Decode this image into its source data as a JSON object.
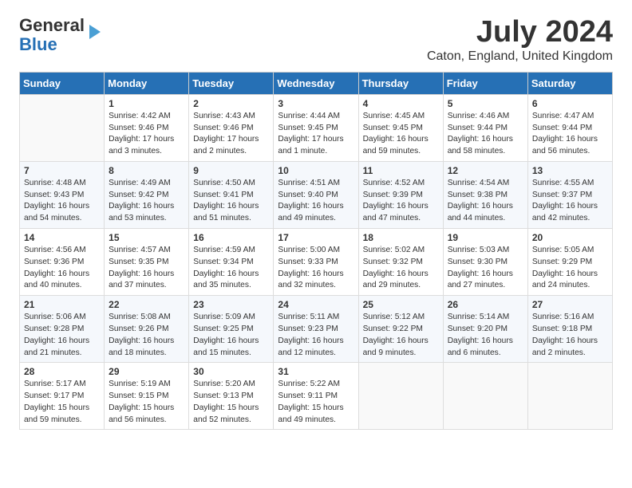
{
  "header": {
    "logo_line1": "General",
    "logo_line2": "Blue",
    "month_year": "July 2024",
    "location": "Caton, England, United Kingdom"
  },
  "calendar": {
    "weekdays": [
      "Sunday",
      "Monday",
      "Tuesday",
      "Wednesday",
      "Thursday",
      "Friday",
      "Saturday"
    ],
    "weeks": [
      [
        {
          "day": "",
          "info": ""
        },
        {
          "day": "1",
          "info": "Sunrise: 4:42 AM\nSunset: 9:46 PM\nDaylight: 17 hours\nand 3 minutes."
        },
        {
          "day": "2",
          "info": "Sunrise: 4:43 AM\nSunset: 9:46 PM\nDaylight: 17 hours\nand 2 minutes."
        },
        {
          "day": "3",
          "info": "Sunrise: 4:44 AM\nSunset: 9:45 PM\nDaylight: 17 hours\nand 1 minute."
        },
        {
          "day": "4",
          "info": "Sunrise: 4:45 AM\nSunset: 9:45 PM\nDaylight: 16 hours\nand 59 minutes."
        },
        {
          "day": "5",
          "info": "Sunrise: 4:46 AM\nSunset: 9:44 PM\nDaylight: 16 hours\nand 58 minutes."
        },
        {
          "day": "6",
          "info": "Sunrise: 4:47 AM\nSunset: 9:44 PM\nDaylight: 16 hours\nand 56 minutes."
        }
      ],
      [
        {
          "day": "7",
          "info": "Sunrise: 4:48 AM\nSunset: 9:43 PM\nDaylight: 16 hours\nand 54 minutes."
        },
        {
          "day": "8",
          "info": "Sunrise: 4:49 AM\nSunset: 9:42 PM\nDaylight: 16 hours\nand 53 minutes."
        },
        {
          "day": "9",
          "info": "Sunrise: 4:50 AM\nSunset: 9:41 PM\nDaylight: 16 hours\nand 51 minutes."
        },
        {
          "day": "10",
          "info": "Sunrise: 4:51 AM\nSunset: 9:40 PM\nDaylight: 16 hours\nand 49 minutes."
        },
        {
          "day": "11",
          "info": "Sunrise: 4:52 AM\nSunset: 9:39 PM\nDaylight: 16 hours\nand 47 minutes."
        },
        {
          "day": "12",
          "info": "Sunrise: 4:54 AM\nSunset: 9:38 PM\nDaylight: 16 hours\nand 44 minutes."
        },
        {
          "day": "13",
          "info": "Sunrise: 4:55 AM\nSunset: 9:37 PM\nDaylight: 16 hours\nand 42 minutes."
        }
      ],
      [
        {
          "day": "14",
          "info": "Sunrise: 4:56 AM\nSunset: 9:36 PM\nDaylight: 16 hours\nand 40 minutes."
        },
        {
          "day": "15",
          "info": "Sunrise: 4:57 AM\nSunset: 9:35 PM\nDaylight: 16 hours\nand 37 minutes."
        },
        {
          "day": "16",
          "info": "Sunrise: 4:59 AM\nSunset: 9:34 PM\nDaylight: 16 hours\nand 35 minutes."
        },
        {
          "day": "17",
          "info": "Sunrise: 5:00 AM\nSunset: 9:33 PM\nDaylight: 16 hours\nand 32 minutes."
        },
        {
          "day": "18",
          "info": "Sunrise: 5:02 AM\nSunset: 9:32 PM\nDaylight: 16 hours\nand 29 minutes."
        },
        {
          "day": "19",
          "info": "Sunrise: 5:03 AM\nSunset: 9:30 PM\nDaylight: 16 hours\nand 27 minutes."
        },
        {
          "day": "20",
          "info": "Sunrise: 5:05 AM\nSunset: 9:29 PM\nDaylight: 16 hours\nand 24 minutes."
        }
      ],
      [
        {
          "day": "21",
          "info": "Sunrise: 5:06 AM\nSunset: 9:28 PM\nDaylight: 16 hours\nand 21 minutes."
        },
        {
          "day": "22",
          "info": "Sunrise: 5:08 AM\nSunset: 9:26 PM\nDaylight: 16 hours\nand 18 minutes."
        },
        {
          "day": "23",
          "info": "Sunrise: 5:09 AM\nSunset: 9:25 PM\nDaylight: 16 hours\nand 15 minutes."
        },
        {
          "day": "24",
          "info": "Sunrise: 5:11 AM\nSunset: 9:23 PM\nDaylight: 16 hours\nand 12 minutes."
        },
        {
          "day": "25",
          "info": "Sunrise: 5:12 AM\nSunset: 9:22 PM\nDaylight: 16 hours\nand 9 minutes."
        },
        {
          "day": "26",
          "info": "Sunrise: 5:14 AM\nSunset: 9:20 PM\nDaylight: 16 hours\nand 6 minutes."
        },
        {
          "day": "27",
          "info": "Sunrise: 5:16 AM\nSunset: 9:18 PM\nDaylight: 16 hours\nand 2 minutes."
        }
      ],
      [
        {
          "day": "28",
          "info": "Sunrise: 5:17 AM\nSunset: 9:17 PM\nDaylight: 15 hours\nand 59 minutes."
        },
        {
          "day": "29",
          "info": "Sunrise: 5:19 AM\nSunset: 9:15 PM\nDaylight: 15 hours\nand 56 minutes."
        },
        {
          "day": "30",
          "info": "Sunrise: 5:20 AM\nSunset: 9:13 PM\nDaylight: 15 hours\nand 52 minutes."
        },
        {
          "day": "31",
          "info": "Sunrise: 5:22 AM\nSunset: 9:11 PM\nDaylight: 15 hours\nand 49 minutes."
        },
        {
          "day": "",
          "info": ""
        },
        {
          "day": "",
          "info": ""
        },
        {
          "day": "",
          "info": ""
        }
      ]
    ]
  }
}
